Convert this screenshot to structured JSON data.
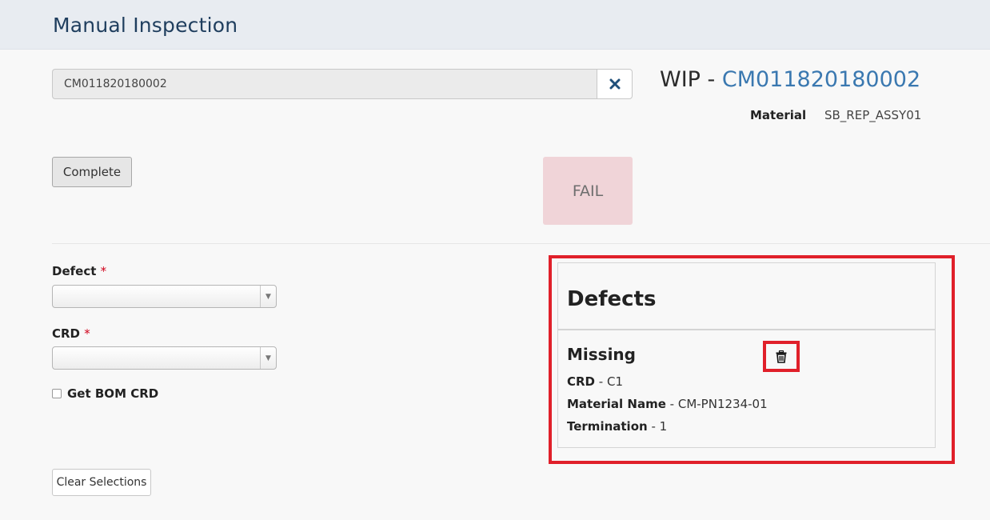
{
  "header": {
    "title": "Manual Inspection"
  },
  "search": {
    "value": "CM011820180002",
    "clear_icon": "times-icon"
  },
  "wip": {
    "prefix": "WIP - ",
    "id": "CM011820180002"
  },
  "material": {
    "label": "Material",
    "value": "SB_REP_ASSY01"
  },
  "actions": {
    "complete_label": "Complete",
    "clear_selections_label": "Clear Selections"
  },
  "status": {
    "text": "FAIL",
    "color": "#f0d4d8"
  },
  "form": {
    "defect": {
      "label": "Defect",
      "required_mark": "*",
      "value": ""
    },
    "crd": {
      "label": "CRD",
      "required_mark": "*",
      "value": ""
    },
    "get_bom_crd": {
      "label": "Get BOM CRD",
      "checked": false
    }
  },
  "defects_panel": {
    "title": "Defects",
    "items": [
      {
        "name": "Missing",
        "crd_label": "CRD",
        "crd_value": " - C1",
        "material_name_label": "Material Name",
        "material_name_value": " - CM-PN1234-01",
        "termination_label": "Termination",
        "termination_value": " - 1",
        "delete_icon": "trash-icon"
      }
    ]
  },
  "colors": {
    "accent": "#3a78b0",
    "title": "#1f3e5e",
    "highlight": "#e0202a",
    "required": "#d0021b"
  }
}
